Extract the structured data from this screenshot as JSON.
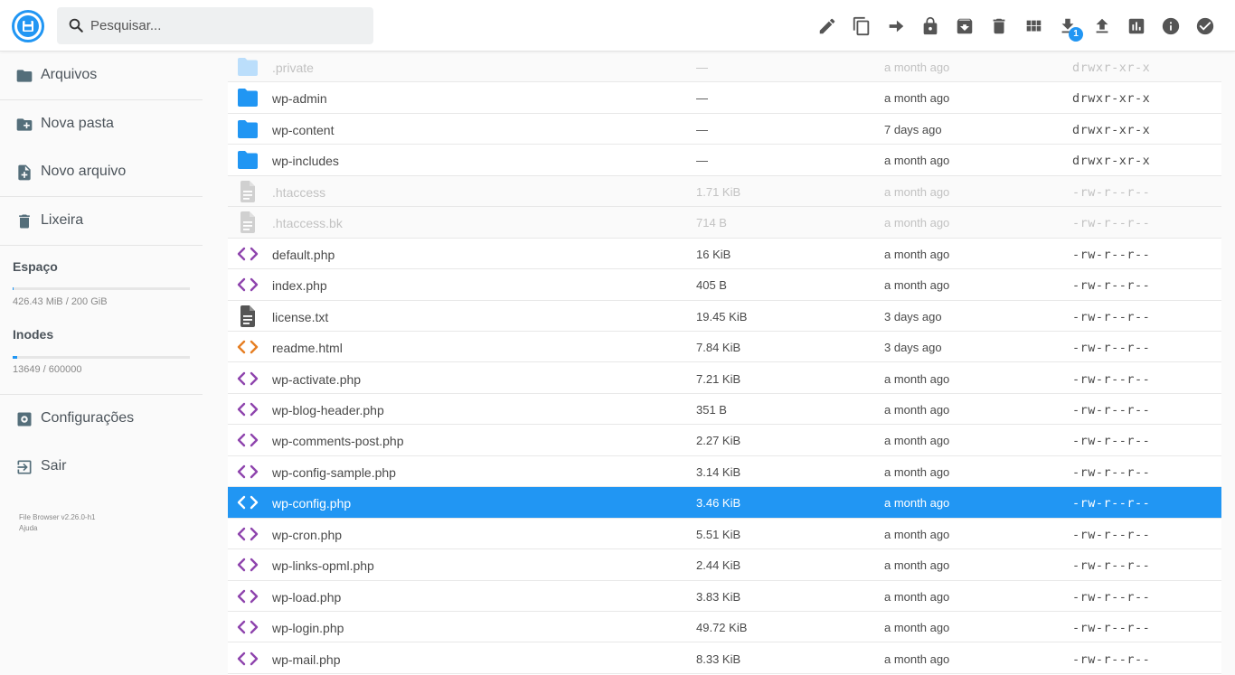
{
  "search": {
    "placeholder": "Pesquisar..."
  },
  "toolbar": {
    "actions": [
      "edit-icon",
      "copy-icon",
      "move-icon",
      "permissions-icon",
      "archive-icon",
      "delete-icon",
      "view-mode-icon",
      "download-icon",
      "upload-icon",
      "info-chart-icon",
      "info-icon",
      "select-icon"
    ],
    "download_badge": "1"
  },
  "sidebar": {
    "items": [
      {
        "label": "Arquivos",
        "icon": "folder-icon"
      },
      {
        "label": "Nova pasta",
        "icon": "new-folder-icon"
      },
      {
        "label": "Novo arquivo",
        "icon": "new-file-icon"
      },
      {
        "label": "Lixeira",
        "icon": "trash-icon"
      }
    ],
    "space": {
      "title": "Espaço",
      "text": "426.43 MiB / 200 GiB",
      "fraction": 0.002
    },
    "inodes": {
      "title": "Inodes",
      "text": "13649 / 600000",
      "fraction": 0.023
    },
    "settings": {
      "label": "Configurações",
      "icon": "settings-icon"
    },
    "logout": {
      "label": "Sair",
      "icon": "logout-icon"
    },
    "credits": {
      "version": "File Browser v2.26.0-h1",
      "help": "Ajuda"
    }
  },
  "files": [
    {
      "name": ".private",
      "size": "—",
      "modified": "a month ago",
      "perms": "drwxr-xr-x",
      "kind": "folder",
      "state": "faded"
    },
    {
      "name": "wp-admin",
      "size": "—",
      "modified": "a month ago",
      "perms": "drwxr-xr-x",
      "kind": "folder",
      "state": "normal"
    },
    {
      "name": "wp-content",
      "size": "—",
      "modified": "7 days ago",
      "perms": "drwxr-xr-x",
      "kind": "folder",
      "state": "normal"
    },
    {
      "name": "wp-includes",
      "size": "—",
      "modified": "a month ago",
      "perms": "drwxr-xr-x",
      "kind": "folder",
      "state": "normal"
    },
    {
      "name": ".htaccess",
      "size": "1.71 KiB",
      "modified": "a month ago",
      "perms": "-rw-r--r--",
      "kind": "text",
      "state": "faded"
    },
    {
      "name": ".htaccess.bk",
      "size": "714 B",
      "modified": "a month ago",
      "perms": "-rw-r--r--",
      "kind": "text",
      "state": "faded"
    },
    {
      "name": "default.php",
      "size": "16 KiB",
      "modified": "a month ago",
      "perms": "-rw-r--r--",
      "kind": "code",
      "state": "normal"
    },
    {
      "name": "index.php",
      "size": "405 B",
      "modified": "a month ago",
      "perms": "-rw-r--r--",
      "kind": "code",
      "state": "normal"
    },
    {
      "name": "license.txt",
      "size": "19.45 KiB",
      "modified": "3 days ago",
      "perms": "-rw-r--r--",
      "kind": "text",
      "state": "normal"
    },
    {
      "name": "readme.html",
      "size": "7.84 KiB",
      "modified": "3 days ago",
      "perms": "-rw-r--r--",
      "kind": "html",
      "state": "normal"
    },
    {
      "name": "wp-activate.php",
      "size": "7.21 KiB",
      "modified": "a month ago",
      "perms": "-rw-r--r--",
      "kind": "code",
      "state": "normal"
    },
    {
      "name": "wp-blog-header.php",
      "size": "351 B",
      "modified": "a month ago",
      "perms": "-rw-r--r--",
      "kind": "code",
      "state": "normal"
    },
    {
      "name": "wp-comments-post.php",
      "size": "2.27 KiB",
      "modified": "a month ago",
      "perms": "-rw-r--r--",
      "kind": "code",
      "state": "normal"
    },
    {
      "name": "wp-config-sample.php",
      "size": "3.14 KiB",
      "modified": "a month ago",
      "perms": "-rw-r--r--",
      "kind": "code",
      "state": "normal"
    },
    {
      "name": "wp-config.php",
      "size": "3.46 KiB",
      "modified": "a month ago",
      "perms": "-rw-r--r--",
      "kind": "code",
      "state": "selected"
    },
    {
      "name": "wp-cron.php",
      "size": "5.51 KiB",
      "modified": "a month ago",
      "perms": "-rw-r--r--",
      "kind": "code",
      "state": "normal"
    },
    {
      "name": "wp-links-opml.php",
      "size": "2.44 KiB",
      "modified": "a month ago",
      "perms": "-rw-r--r--",
      "kind": "code",
      "state": "normal"
    },
    {
      "name": "wp-load.php",
      "size": "3.83 KiB",
      "modified": "a month ago",
      "perms": "-rw-r--r--",
      "kind": "code",
      "state": "normal"
    },
    {
      "name": "wp-login.php",
      "size": "49.72 KiB",
      "modified": "a month ago",
      "perms": "-rw-r--r--",
      "kind": "code",
      "state": "normal"
    },
    {
      "name": "wp-mail.php",
      "size": "8.33 KiB",
      "modified": "a month ago",
      "perms": "-rw-r--r--",
      "kind": "code",
      "state": "normal"
    }
  ],
  "colors": {
    "accent": "#2196f3",
    "folder": "#2196f3",
    "code": "#8e44ad",
    "html": "#e67e22",
    "text_icon": "#555555"
  }
}
